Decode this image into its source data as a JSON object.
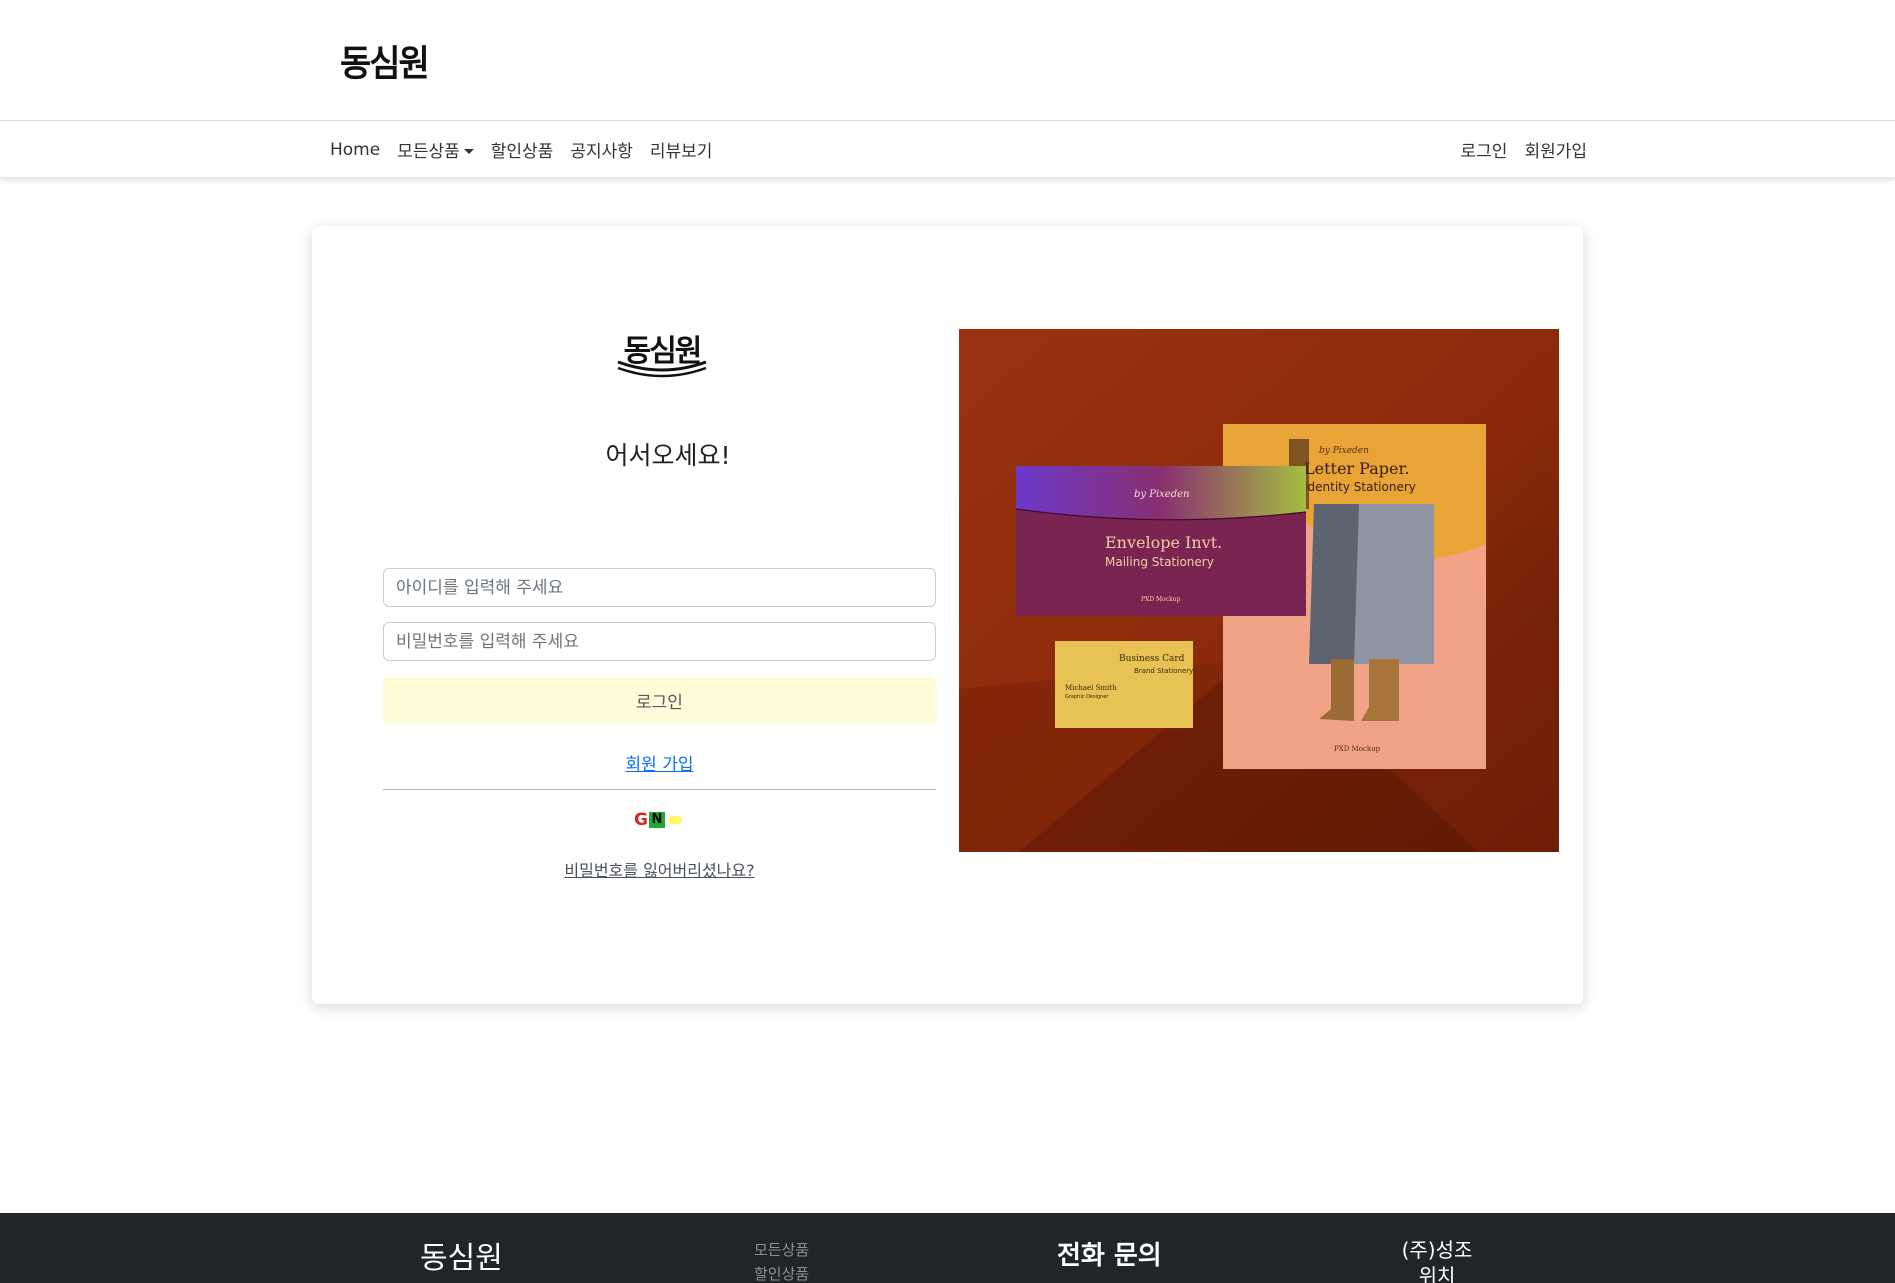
{
  "brand": {
    "logo_text": "동심원"
  },
  "nav": {
    "home": "Home",
    "all_products": "모든상품",
    "discount_products": "할인상품",
    "notice": "공지사항",
    "reviews": "리뷰보기",
    "login": "로그인",
    "signup": "회원가입"
  },
  "login_card": {
    "logo_text": "동심원",
    "welcome": "어서오세요!",
    "id_placeholder": "아이디를 입력해 주세요",
    "password_placeholder": "비밀번호를 입력해 주세요",
    "login_button": "로그인",
    "signup_link": "회원 가입",
    "social": {
      "google_letter": "G",
      "naver_letter": "N"
    },
    "forgot_password": "비밀번호를 잃어버리셨나요?"
  },
  "photo": {
    "envelope_by": "by Pixeden",
    "envelope_title": "Envelope Invt.",
    "envelope_subtitle": "Mailing Stationery",
    "letter_by": "by Pixeden",
    "letter_title": "Letter Paper.",
    "letter_subtitle": "Identity Stationery",
    "card_title": "Business Card",
    "card_subtitle": "Brand Stationery",
    "card_name": "Michael Smith",
    "card_role": "Graphic Designer",
    "mockup_label": "PXD Mockup"
  },
  "footer": {
    "brand": "동심원",
    "links": [
      "모든상품",
      "할인상품"
    ],
    "phone_heading": "전화 문의",
    "company_lines": [
      "(주)성조",
      "위치"
    ]
  },
  "colors": {
    "login_button_bg": "#fffcd9",
    "link_blue": "#0d6efd",
    "footer_bg": "#212529",
    "photo_bg": "#8f2a0c"
  }
}
